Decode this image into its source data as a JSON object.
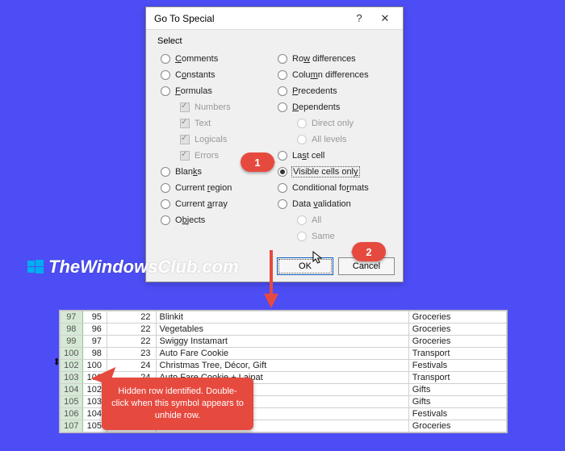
{
  "dialog": {
    "title": "Go To Special",
    "help": "?",
    "close": "✕",
    "select_label": "Select",
    "left": {
      "comments": "Comments",
      "constants": "Constants",
      "formulas": "Formulas",
      "numbers": "Numbers",
      "text": "Text",
      "logicals": "Logicals",
      "errors": "Errors",
      "blanks": "Blanks",
      "current_region": "Current region",
      "current_array": "Current array",
      "objects": "Objects"
    },
    "right": {
      "row_diff": "Row differences",
      "col_diff": "Column differences",
      "precedents": "Precedents",
      "dependents": "Dependents",
      "direct_only": "Direct only",
      "all_levels": "All levels",
      "last_cell": "Last cell",
      "visible_cells": "Visible cells only",
      "cond_formats": "Conditional formats",
      "data_validation": "Data validation",
      "all": "All",
      "same": "Same"
    },
    "ok": "OK",
    "cancel": "Cancel"
  },
  "badges": {
    "one": "1",
    "two": "2"
  },
  "watermark": "TheWindowsClub.com",
  "callout": "Hidden row identified. Double-click when this symbol appears to unhide row.",
  "rows": [
    {
      "hdr": "97",
      "a": "95",
      "b": "22",
      "c": "Blinkit",
      "d": "Groceries"
    },
    {
      "hdr": "98",
      "a": "96",
      "b": "22",
      "c": "Vegetables",
      "d": "Groceries"
    },
    {
      "hdr": "99",
      "a": "97",
      "b": "22",
      "c": "Swiggy Instamart",
      "d": "Groceries"
    },
    {
      "hdr": "100",
      "a": "98",
      "b": "23",
      "c": "Auto Fare Cookie",
      "d": "Transport"
    },
    {
      "hdr": "102",
      "a": "100",
      "b": "24",
      "c": "Christmas Tree, Décor, Gift",
      "d": "Festivals",
      "thick": true
    },
    {
      "hdr": "103",
      "a": "101",
      "b": "24",
      "c": "Auto Fare Cookie + Lajpat",
      "d": "Transport"
    },
    {
      "hdr": "104",
      "a": "102",
      "b": "",
      "c": "",
      "d": "Gifts"
    },
    {
      "hdr": "105",
      "a": "103",
      "b": "",
      "c": "",
      "d": "Gifts"
    },
    {
      "hdr": "106",
      "a": "104",
      "b": "",
      "c": "",
      "d": "Festivals"
    },
    {
      "hdr": "107",
      "a": "105",
      "b": "",
      "c": "",
      "d": "Groceries"
    }
  ]
}
